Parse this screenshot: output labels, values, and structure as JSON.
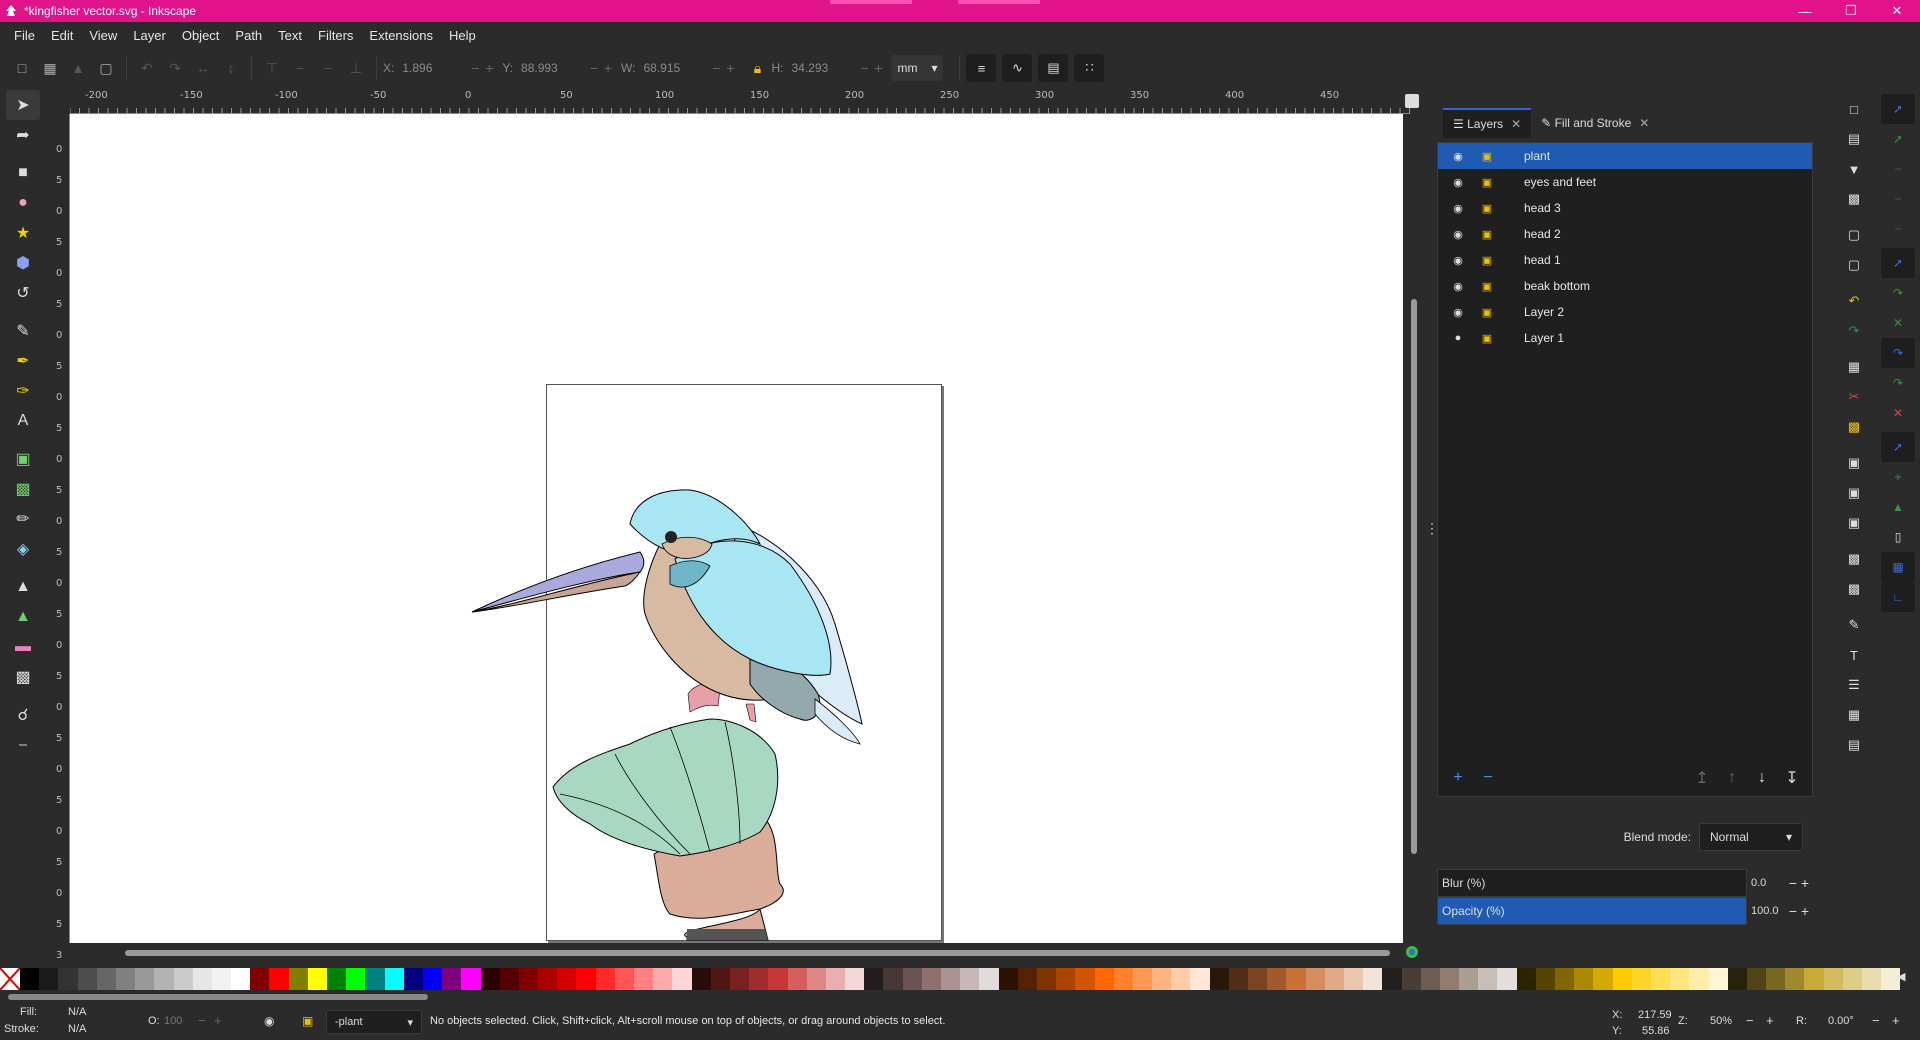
{
  "app": {
    "title": "*kingfisher vector.svg - Inkscape"
  },
  "menu": [
    "File",
    "Edit",
    "View",
    "Layer",
    "Object",
    "Path",
    "Text",
    "Filters",
    "Extensions",
    "Help"
  ],
  "toolbar": {
    "x_label": "X:",
    "x_value": "1.896",
    "y_label": "Y:",
    "y_value": "88.993",
    "w_label": "W:",
    "w_value": "68.915",
    "h_label": "H:",
    "h_value": "34.293",
    "unit": "mm"
  },
  "ruler": {
    "top_ticks": [
      "-200",
      "-150",
      "-100",
      "-50",
      "0",
      "50",
      "100",
      "150",
      "200",
      "250",
      "300",
      "350",
      "400",
      "450"
    ],
    "left_ticks": [
      "0",
      "5",
      "0",
      "5",
      "0",
      "5",
      "0",
      "5",
      "0",
      "5",
      "0",
      "5",
      "0",
      "5",
      "0",
      "5",
      "0",
      "5",
      "0",
      "5",
      "0",
      "5",
      "0",
      "5",
      "0",
      "5",
      "3"
    ]
  },
  "dock": {
    "tabs": [
      {
        "label": "Layers",
        "icon": "layers-icon"
      },
      {
        "label": "Fill and Stroke",
        "icon": "fill-stroke-icon"
      }
    ],
    "layers": [
      {
        "name": "plant",
        "selected": true
      },
      {
        "name": "eyes and feet",
        "selected": false
      },
      {
        "name": "head 3",
        "selected": false
      },
      {
        "name": "head 2",
        "selected": false
      },
      {
        "name": "head 1",
        "selected": false
      },
      {
        "name": "beak bottom",
        "selected": false
      },
      {
        "name": "Layer 2",
        "selected": false
      },
      {
        "name": "Layer 1",
        "selected": false
      }
    ],
    "blend_label": "Blend mode:",
    "blend_value": "Normal",
    "blur_label": "Blur (%)",
    "blur_value": "0.0",
    "opacity_label": "Opacity (%)",
    "opacity_value": "100.0",
    "opacity_level": 1.0
  },
  "status": {
    "fill_label": "Fill:",
    "fill_value": "N/A",
    "stroke_label": "Stroke:",
    "stroke_value": "N/A",
    "opacity_label": "O:",
    "opacity_value": "100",
    "current_layer": "-plant",
    "message": "No objects selected. Click, Shift+click, Alt+scroll mouse on top of objects, or drag around objects to select.",
    "cursor_x_label": "X:",
    "cursor_x": "217.59",
    "cursor_y_label": "Y:",
    "cursor_y": "55.86",
    "zoom_label": "Z:",
    "zoom": "50%",
    "rotation_label": "R:",
    "rotation": "0.00°"
  },
  "colors": {
    "titlebar": "#e0138a",
    "accent": "#1f5bb3",
    "bird_blue": "#a8e6f4",
    "bird_body": "#d8b9a2",
    "plant_green": "#a9d8c2",
    "pot": "#d9ad9a"
  }
}
